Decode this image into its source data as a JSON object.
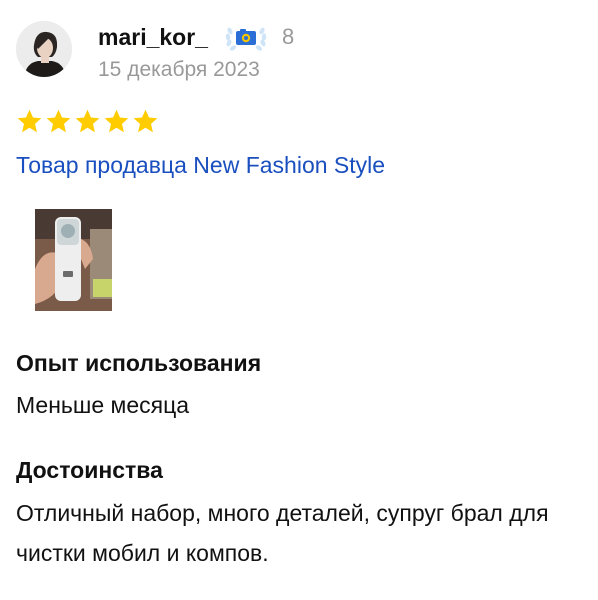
{
  "review": {
    "author": {
      "username": "mari_kor_",
      "badge_icon": "camera-laurel-icon",
      "badge_count": "8",
      "date": "15 декабря 2023"
    },
    "rating": {
      "value": 5,
      "max": 5,
      "star_color": "#ffcc00"
    },
    "seller_link": "Товар продавца New Fashion Style",
    "photos": [
      {
        "icon": "product-photo-thumbnail"
      }
    ],
    "sections": [
      {
        "title": "Опыт использования",
        "text": "Меньше месяца"
      },
      {
        "title": "Достоинства",
        "text": "Отличный набор, много деталей, супруг брал для чистки мобил и компов."
      }
    ]
  },
  "colors": {
    "link": "#1a4fbf",
    "muted": "#999999",
    "text": "#111111",
    "star": "#ffcc00"
  }
}
